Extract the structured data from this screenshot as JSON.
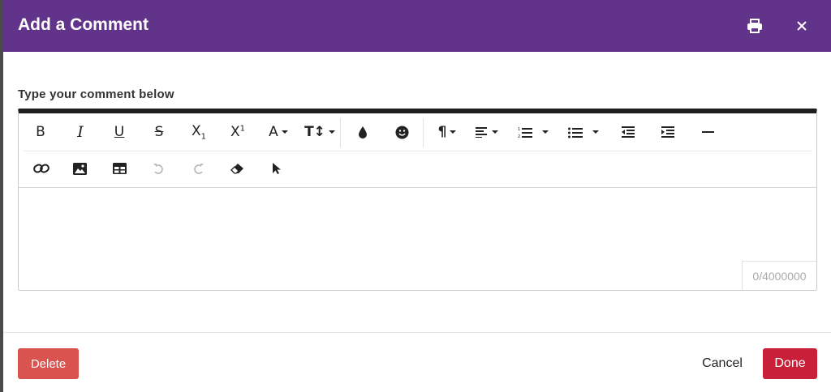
{
  "dialog": {
    "title": "Add a Comment",
    "print_icon": "print-icon",
    "close_icon": "close-icon",
    "prompt_label": "Type your comment below"
  },
  "editor": {
    "toolbar_row1": [
      {
        "name": "bold-button",
        "icon": "bold-icon",
        "text": "B"
      },
      {
        "name": "italic-button",
        "icon": "italic-icon",
        "text": "I"
      },
      {
        "name": "underline-button",
        "icon": "underline-icon",
        "text": "U"
      },
      {
        "name": "strikethrough-button",
        "icon": "strikethrough-icon",
        "text": "S"
      },
      {
        "name": "subscript-button",
        "icon": "subscript-icon"
      },
      {
        "name": "superscript-button",
        "icon": "superscript-icon"
      },
      {
        "name": "font-family-button",
        "icon": "font-icon"
      },
      {
        "name": "font-size-button",
        "icon": "text-size-icon"
      },
      {
        "name": "text-color-button",
        "icon": "color-drop-icon"
      },
      {
        "name": "emoticons-button",
        "icon": "smile-icon"
      },
      {
        "name": "paragraph-format-button",
        "icon": "paragraph-icon"
      },
      {
        "name": "align-button",
        "icon": "align-left-icon"
      },
      {
        "name": "ordered-list-button",
        "icon": "ordered-list-icon"
      },
      {
        "name": "unordered-list-button",
        "icon": "unordered-list-icon"
      },
      {
        "name": "outdent-button",
        "icon": "outdent-icon"
      },
      {
        "name": "indent-button",
        "icon": "indent-icon"
      },
      {
        "name": "horizontal-line-button",
        "icon": "horizontal-line-icon"
      }
    ],
    "toolbar_row2": [
      {
        "name": "insert-link-button",
        "icon": "link-icon"
      },
      {
        "name": "insert-image-button",
        "icon": "image-icon"
      },
      {
        "name": "insert-table-button",
        "icon": "table-icon"
      },
      {
        "name": "undo-button",
        "icon": "undo-icon"
      },
      {
        "name": "redo-button",
        "icon": "redo-icon"
      },
      {
        "name": "clear-formatting-button",
        "icon": "eraser-icon"
      },
      {
        "name": "select-all-button",
        "icon": "cursor-icon"
      }
    ],
    "char_counter": "0/4000000",
    "content": ""
  },
  "footer": {
    "delete_label": "Delete",
    "cancel_label": "Cancel",
    "done_label": "Done"
  },
  "colors": {
    "header": "#61338a",
    "delete": "#d9534f",
    "done": "#c9203a"
  }
}
